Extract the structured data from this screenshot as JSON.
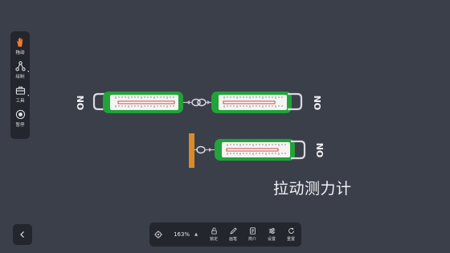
{
  "rail": {
    "tools": [
      {
        "label": "拖动",
        "icon": "hand-icon"
      },
      {
        "label": "绘制",
        "icon": "draw-nodes-icon"
      },
      {
        "label": "工具",
        "icon": "toolbox-icon"
      },
      {
        "label": "暂停",
        "icon": "pause-record-icon"
      }
    ]
  },
  "toolbar": {
    "zoom": "163%",
    "items": [
      {
        "label": "锁定",
        "icon": "lock-icon"
      },
      {
        "label": "画笔",
        "icon": "pen-icon"
      },
      {
        "label": "简介",
        "icon": "document-icon"
      },
      {
        "label": "设置",
        "icon": "sliders-icon"
      },
      {
        "label": "重置",
        "icon": "reset-icon"
      }
    ]
  },
  "scene": {
    "caption": "拉动测力计",
    "meter_end_label": "NO",
    "colors": {
      "casing": "#21a33a",
      "hook": "#d8dadf",
      "wall": "#d98b2b",
      "indicator": "#c23232",
      "background": "#3b3f4a"
    }
  }
}
